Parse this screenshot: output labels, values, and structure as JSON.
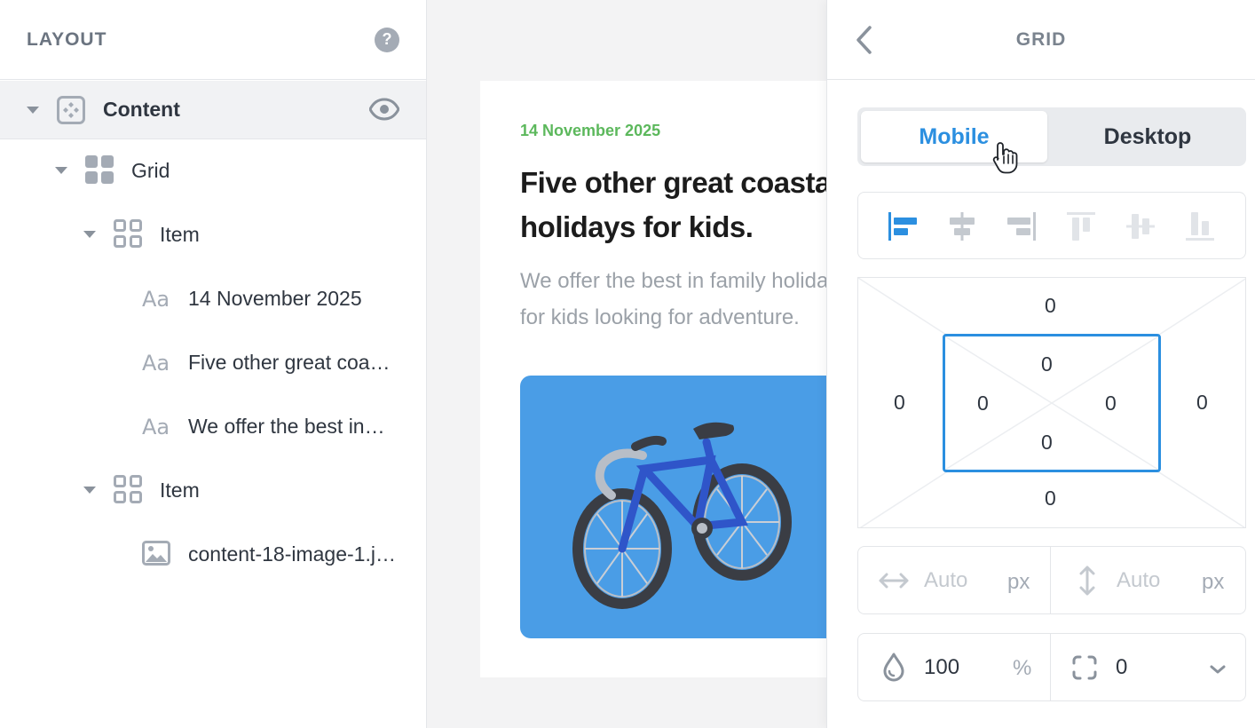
{
  "layout_panel": {
    "title": "LAYOUT",
    "help": "?",
    "tree": [
      {
        "label": "Content",
        "icon": "component-icon"
      },
      {
        "label": "Grid",
        "icon": "grid-icon"
      },
      {
        "label": "Item",
        "icon": "grid-item-icon"
      },
      {
        "label": "14 November 2025",
        "icon": "text-icon"
      },
      {
        "label": "Five other great coa…",
        "icon": "text-icon"
      },
      {
        "label": "We offer the best in…",
        "icon": "text-icon"
      },
      {
        "label": "Item",
        "icon": "grid-item-icon"
      },
      {
        "label": "content-18-image-1.j…",
        "icon": "image-icon"
      }
    ]
  },
  "canvas": {
    "date": "14 November 2025",
    "title": "Five other great coastal holidays for kids.",
    "text": "We offer the best in family holidays, perfect for kids looking for adventure."
  },
  "grid_panel": {
    "title": "GRID",
    "tabs": {
      "mobile": "Mobile",
      "desktop": "Desktop",
      "active": "Mobile"
    },
    "margin": {
      "top": "0",
      "right": "0",
      "bottom": "0",
      "left": "0"
    },
    "padding": {
      "top": "0",
      "right": "0",
      "bottom": "0",
      "left": "0"
    },
    "width": {
      "placeholder": "Auto",
      "unit": "px"
    },
    "height": {
      "placeholder": "Auto",
      "unit": "px"
    },
    "opacity": {
      "value": "100",
      "unit": "%"
    },
    "radius": {
      "value": "0"
    }
  },
  "colors": {
    "accent": "#2b8fe0",
    "date_green": "#5cb85c",
    "image_bg": "#4a9de6"
  }
}
